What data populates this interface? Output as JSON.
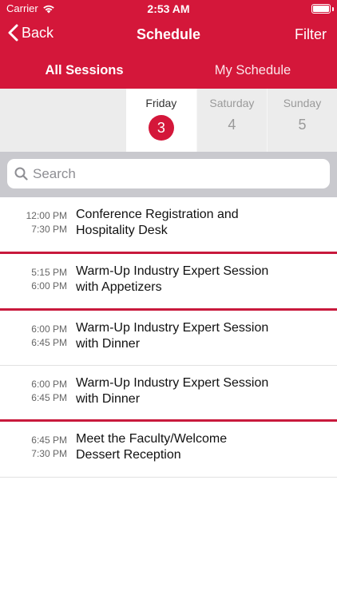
{
  "status": {
    "carrier": "Carrier",
    "time": "2:53 AM"
  },
  "nav": {
    "back_label": "Back",
    "title": "Schedule",
    "filter_label": "Filter"
  },
  "tabs": [
    {
      "label": "All Sessions",
      "active": true
    },
    {
      "label": "My Schedule",
      "active": false
    }
  ],
  "days": [
    {
      "name": "Friday",
      "number": "3",
      "active": true
    },
    {
      "name": "Saturday",
      "number": "4",
      "active": false
    },
    {
      "name": "Sunday",
      "number": "5",
      "active": false
    }
  ],
  "search": {
    "placeholder": "Search"
  },
  "sessions": [
    {
      "start": "12:00 PM",
      "end": "7:30 PM",
      "title_line1": "Conference Registration and",
      "title_line2": "Hospitality Desk"
    },
    {
      "start": "5:15 PM",
      "end": "6:00 PM",
      "title_line1": "Warm-Up Industry Expert Session",
      "title_line2": "with Appetizers"
    },
    {
      "start": "6:00 PM",
      "end": "6:45 PM",
      "title_line1": "Warm-Up Industry Expert Session",
      "title_line2": "with Dinner"
    },
    {
      "start": "6:00 PM",
      "end": "6:45 PM",
      "title_line1": "Warm-Up Industry Expert Session",
      "title_line2": "with Dinner"
    },
    {
      "start": "6:45 PM",
      "end": "7:30 PM",
      "title_line1": "Meet the Faculty/Welcome",
      "title_line2": "Dessert Reception"
    }
  ],
  "colors": {
    "accent": "#d4173a",
    "separator_red": "#c8193c",
    "separator_gray": "#e2e2e2"
  }
}
